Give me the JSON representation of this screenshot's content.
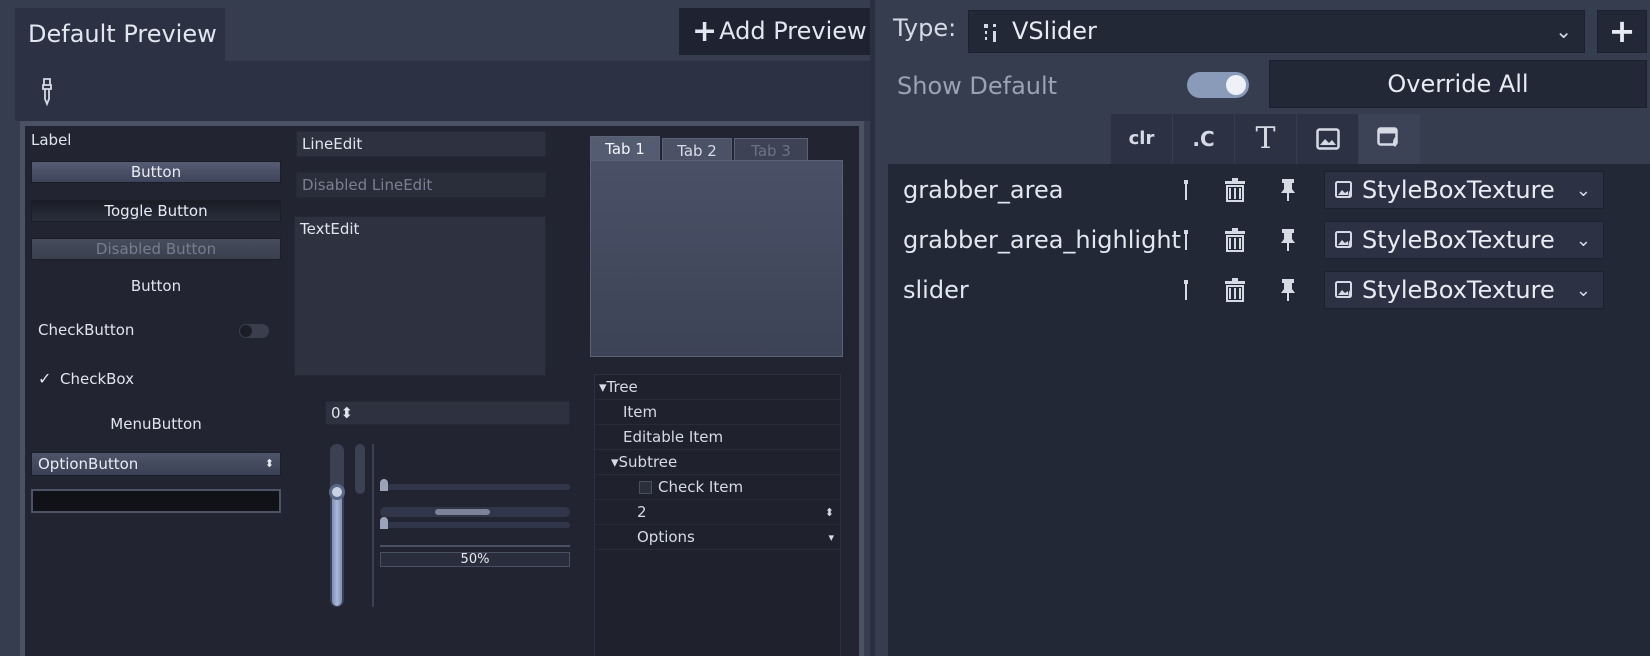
{
  "preview_panel": {
    "tab_label": "Default Preview",
    "add_preview_label": "Add Preview",
    "picker_icon": "eyedropper-icon",
    "controls": {
      "label": "Label",
      "button": "Button",
      "toggle_button": "Toggle Button",
      "disabled_button": "Disabled Button",
      "flat_button": "Button",
      "check_button": "CheckButton",
      "check_box": "CheckBox",
      "menu_button": "MenuButton",
      "option_button": "OptionButton",
      "line_edit": "LineEdit",
      "disabled_line_edit": "Disabled LineEdit",
      "text_edit": "TextEdit",
      "spinbox_value": "0",
      "progress": "50%",
      "tabs": [
        "Tab 1",
        "Tab 2",
        "Tab 3"
      ],
      "tree": {
        "root": "Tree",
        "item": "Item",
        "editable_item": "Editable Item",
        "subtree": "Subtree",
        "check_item": "Check Item",
        "range_value": "2",
        "options": "Options"
      }
    }
  },
  "theme_editor": {
    "type_label": "Type:",
    "type_value": "VSlider",
    "add_type_label": "+",
    "show_default_label": "Show Default",
    "show_default_on": true,
    "override_all_label": "Override All",
    "data_type_tabs": [
      {
        "label": "clr",
        "icon": "color-icon"
      },
      {
        "label": ".C",
        "icon": "constant-icon"
      },
      {
        "label": "T",
        "icon": "font-icon"
      },
      {
        "label": "",
        "icon": "image-icon"
      },
      {
        "label": "",
        "icon": "stylebox-icon"
      }
    ],
    "items": [
      {
        "name": "grabber_area",
        "resource": "StyleBoxTexture"
      },
      {
        "name": "grabber_area_highlight",
        "resource": "StyleBoxTexture"
      },
      {
        "name": "slider",
        "resource": "StyleBoxTexture"
      }
    ]
  },
  "colors": {
    "panel": "#363d4f",
    "dark_panel": "#232837",
    "accent": "#8a9ab9",
    "text": "#e2e6ef"
  }
}
